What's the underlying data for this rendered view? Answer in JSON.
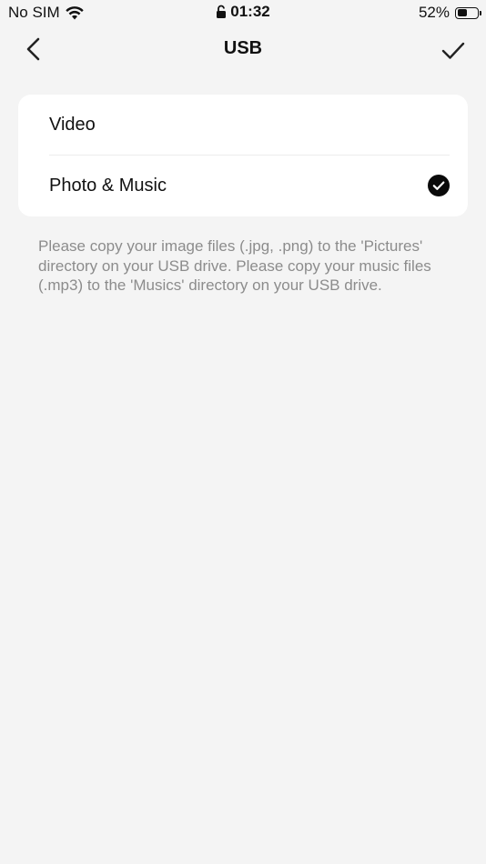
{
  "status_bar": {
    "carrier": "No SIM",
    "time": "01:32",
    "battery_percent": "52%",
    "battery_level": 0.52
  },
  "nav": {
    "title": "USB",
    "back_icon": "chevron-left-icon",
    "done_icon": "checkmark-icon"
  },
  "options": [
    {
      "label": "Video",
      "selected": false
    },
    {
      "label": "Photo & Music",
      "selected": true
    }
  ],
  "info": "Please copy your image files (.jpg, .png) to the 'Pictures' directory on your USB drive. Please copy your music files (.mp3) to the 'Musics' directory on your USB drive.",
  "colors": {
    "background": "#f4f4f4",
    "card": "#ffffff",
    "text": "#111111",
    "secondary_text": "#8c8c8c",
    "check": "#0a0a0a"
  }
}
